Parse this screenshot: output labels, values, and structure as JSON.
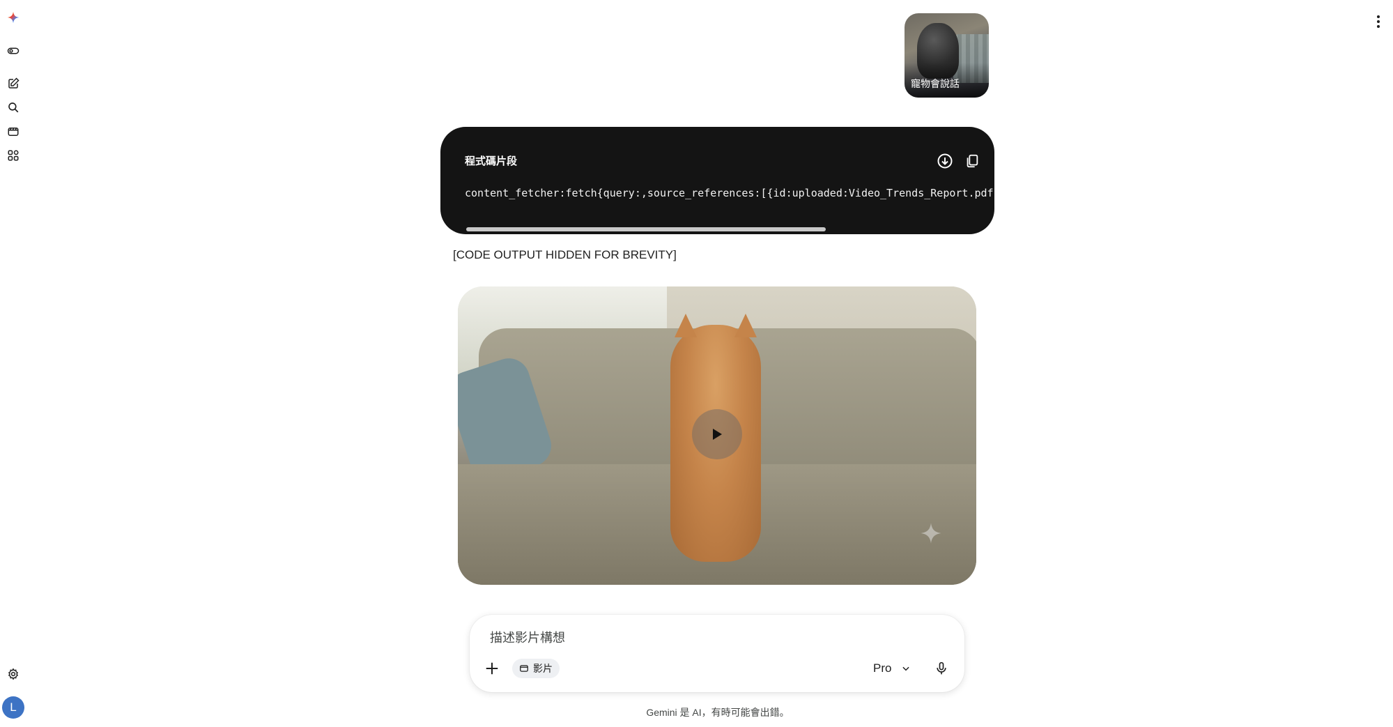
{
  "app": {
    "name": "Gemini"
  },
  "header": {
    "menu_icon": "more-vert-icon"
  },
  "sidebar": {
    "items": [
      {
        "name": "gemini-logo",
        "icon": "gemini-spark-icon"
      },
      {
        "name": "toggle-sidebar",
        "icon": "toggle-icon"
      },
      {
        "name": "new-chat",
        "icon": "edit-icon"
      },
      {
        "name": "search",
        "icon": "search-icon"
      },
      {
        "name": "video-tools",
        "icon": "video-icon"
      },
      {
        "name": "apps",
        "icon": "apps-icon"
      }
    ],
    "settings_icon": "gear-icon",
    "avatar_letter": "L"
  },
  "thumbnail": {
    "caption": "寵物會說話"
  },
  "code_block": {
    "title": "程式碼片段",
    "code": "content_fetcher:fetch{query:,source_references:[{id:uploaded:Video_Trends_Report.pdf",
    "download_icon": "download-icon",
    "copy_icon": "copy-icon",
    "scroll_fraction": 0.69
  },
  "note": "[CODE OUTPUT HIDDEN FOR BREVITY]",
  "video": {
    "play_icon": "play-icon",
    "watermark_icon": "spark-icon"
  },
  "composer": {
    "placeholder": "描述影片構想",
    "chip_label": "影片",
    "model": "Pro",
    "add_icon": "plus-icon",
    "mic_icon": "mic-icon"
  },
  "footer": "Gemini 是 AI，有時可能會出錯。",
  "colors": {
    "code_bg": "#141414",
    "avatar": "#3d73c4",
    "chip_bg": "#eef0f3"
  }
}
